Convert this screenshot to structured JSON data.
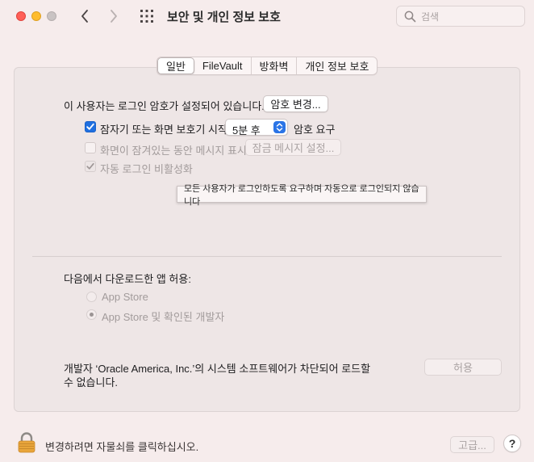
{
  "window": {
    "title": "보안 및 개인 정보 보호"
  },
  "search": {
    "placeholder": "검색",
    "icon": "magnifier-icon"
  },
  "tabs": [
    {
      "label": "일반",
      "selected": true
    },
    {
      "label": "FileVault",
      "selected": false
    },
    {
      "label": "방화벽",
      "selected": false
    },
    {
      "label": "개인 정보 보호",
      "selected": false
    }
  ],
  "general": {
    "password_text": "이 사용자는 로그인 암호가 설정되어 있습니다.",
    "change_password_button": "암호 변경...",
    "require_password_label": "잠자기 또는 화면 보호기 시작",
    "require_password_checked": true,
    "require_password_delay": "5분 후",
    "require_password_suffix": "암호 요구",
    "show_message_label": "화면이 잠겨있는 동안 메시지 표시",
    "show_message_checked": false,
    "lock_message_button": "잠금 메시지 설정...",
    "disable_autologin_label": "자동 로그인 비활성화",
    "disable_autologin_checked": true,
    "tooltip": "모든 사용자가 로그인하도록 요구하며 자동으로 로그인되지 않습니다"
  },
  "downloads": {
    "heading": "다음에서 다운로드한 앱 허용:",
    "options": [
      {
        "label": "App Store",
        "selected": false
      },
      {
        "label": "App Store 및 확인된 개발자",
        "selected": true
      }
    ]
  },
  "blocked": {
    "line1": "개발자 ‘Oracle America, Inc.’의 시스템 소프트웨어가 차단되어 로드할",
    "line2": "수 없습니다.",
    "allow_button": "허용"
  },
  "footer": {
    "lock_text": "변경하려면 자물쇠를 클릭하십시오.",
    "advanced_button": "고급...",
    "help_label": "?"
  },
  "colors": {
    "accent": "#1f6fe0",
    "background": "#f6ecec"
  }
}
